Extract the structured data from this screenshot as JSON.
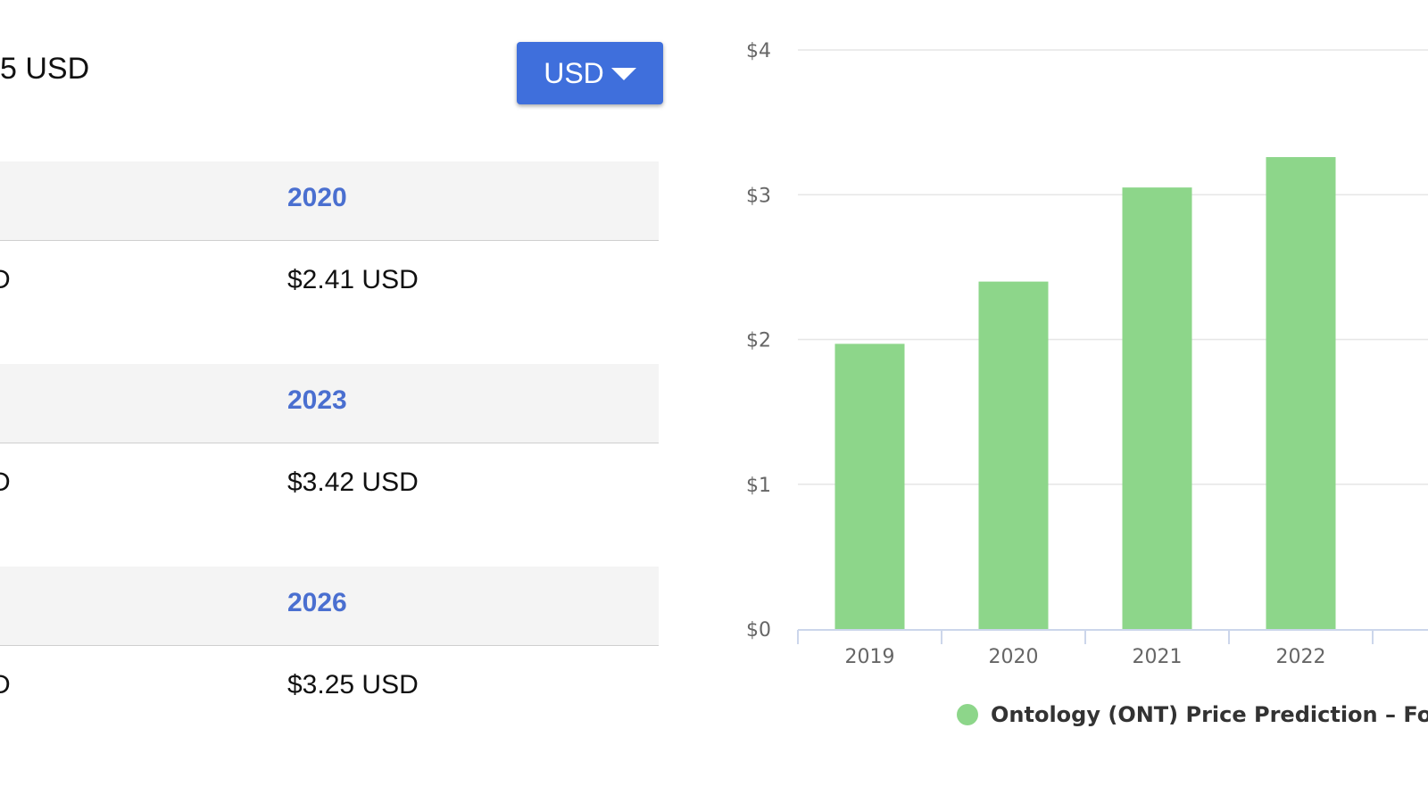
{
  "left_panel": {
    "current_price_text": "5 USD",
    "currency_button": {
      "label": "USD",
      "icon": "caret-down-icon"
    },
    "table": {
      "groups": [
        {
          "year": "2020",
          "left_value": "D",
          "value": "$2.41 USD"
        },
        {
          "year": "2023",
          "left_value": "D",
          "value": "$3.42 USD"
        },
        {
          "year": "2026",
          "left_value": "D",
          "value": "$3.25 USD"
        }
      ]
    },
    "colors": {
      "accent": "#3f6fdc",
      "year_text": "#4a6fd0",
      "header_bg": "#f4f4f4"
    }
  },
  "chart_data": {
    "type": "bar",
    "categories": [
      "2019",
      "2020",
      "2021",
      "2022"
    ],
    "series": [
      {
        "name": "Ontology (ONT) Price Prediction – Fo",
        "values": [
          1.97,
          2.4,
          3.05,
          3.26
        ],
        "color": "#8dd68a"
      }
    ],
    "y_ticks": [
      "$0",
      "$1",
      "$2",
      "$3",
      "$4"
    ],
    "ylim": [
      0,
      4
    ],
    "grid": true,
    "legend_position": "bottom",
    "title": "",
    "xlabel": "",
    "ylabel": ""
  }
}
